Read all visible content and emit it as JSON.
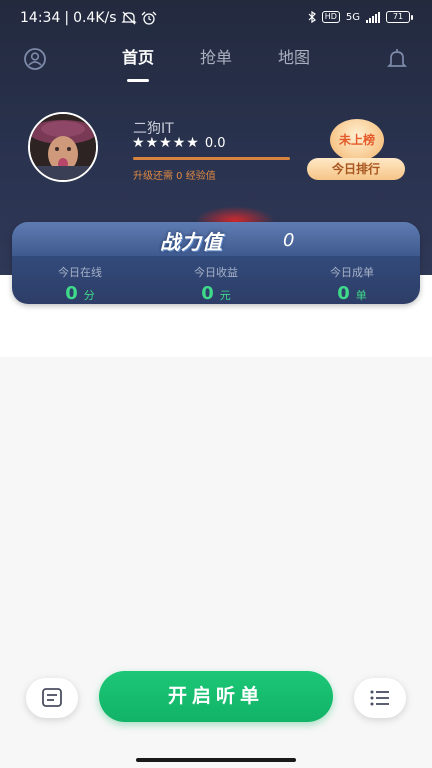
{
  "status_bar": {
    "time": "14:34",
    "net_speed": "0.4K/s",
    "battery": "71",
    "network": "5G",
    "hd": "HD"
  },
  "nav": {
    "tabs": [
      {
        "label": "首页",
        "active": true
      },
      {
        "label": "抢单",
        "active": false
      },
      {
        "label": "地图",
        "active": false
      }
    ],
    "left_icon": "user-icon",
    "right_icon": "bell-icon"
  },
  "profile": {
    "username": "二狗IT",
    "stars": 5,
    "rating": "0.0",
    "upgrade_text": "升级还需 0 经验值"
  },
  "rank": {
    "badge": "未上榜",
    "button": "今日排行"
  },
  "power": {
    "title": "战力值",
    "value": "0",
    "stats": [
      {
        "label": "今日在线",
        "value": "0",
        "unit": "分"
      },
      {
        "label": "今日收益",
        "value": "0",
        "unit": "元"
      },
      {
        "label": "今日成单",
        "value": "0",
        "unit": "单"
      }
    ]
  },
  "bottom": {
    "start_label": "开启听单",
    "left_icon": "message-icon",
    "right_icon": "list-icon"
  },
  "colors": {
    "accent_green": "#14b96c",
    "header_bg": "#262e45",
    "stat_green": "#3fd98a",
    "orange": "#e08a44"
  }
}
